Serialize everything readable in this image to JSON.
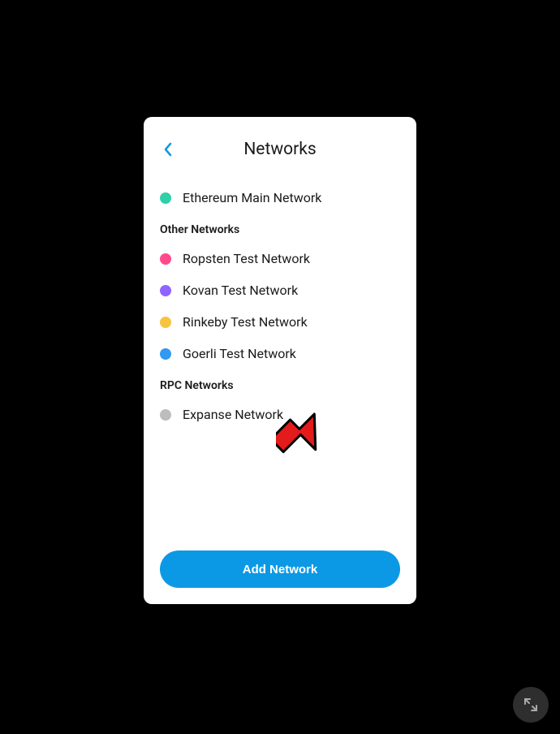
{
  "title": "Networks",
  "main_network": {
    "label": "Ethereum Main Network",
    "color": "#2ecfa9"
  },
  "sections": {
    "other": {
      "header": "Other Networks",
      "items": [
        {
          "label": "Ropsten Test Network",
          "color": "#ff4a8d"
        },
        {
          "label": "Kovan Test Network",
          "color": "#9064ff"
        },
        {
          "label": "Rinkeby Test Network",
          "color": "#f6c343"
        },
        {
          "label": "Goerli Test Network",
          "color": "#3099f2"
        }
      ]
    },
    "rpc": {
      "header": "RPC Networks",
      "items": [
        {
          "label": "Expanse Network",
          "color": "#bdbdbd"
        }
      ]
    }
  },
  "add_button": "Add Network"
}
